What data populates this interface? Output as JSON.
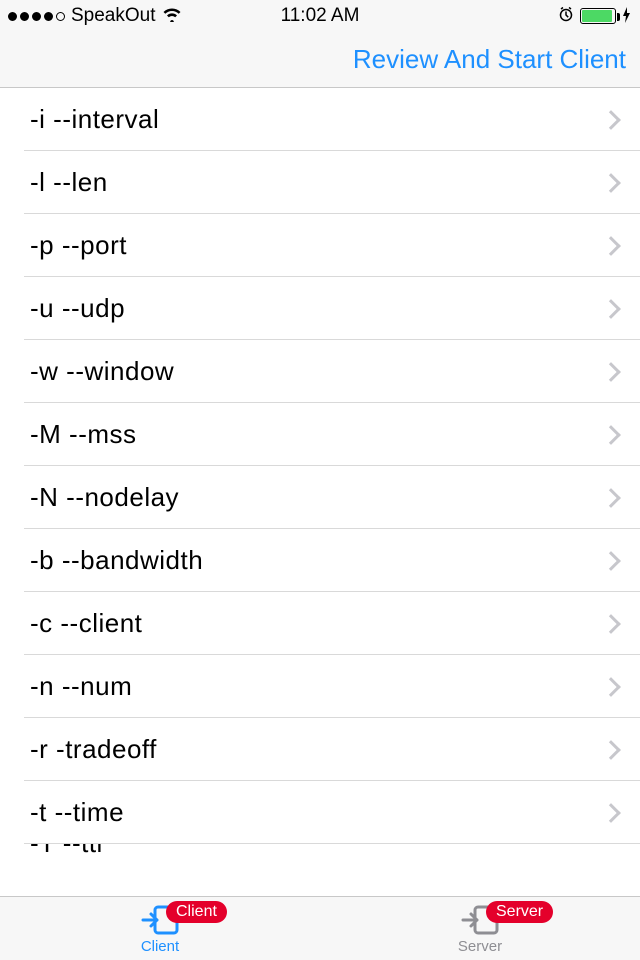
{
  "status": {
    "carrier": "SpeakOut",
    "time": "11:02 AM"
  },
  "nav": {
    "action_label": "Review And Start Client"
  },
  "options": [
    {
      "label": "-i  --interval"
    },
    {
      "label": "-l  --len"
    },
    {
      "label": "-p  --port"
    },
    {
      "label": "-u  --udp"
    },
    {
      "label": "-w  --window"
    },
    {
      "label": "-M  --mss"
    },
    {
      "label": "-N  --nodelay"
    },
    {
      "label": "-b --bandwidth"
    },
    {
      "label": "-c --client"
    },
    {
      "label": "-n --num"
    },
    {
      "label": "-r -tradeoff"
    },
    {
      "label": "-t --time"
    },
    {
      "label": "-T --ttl"
    }
  ],
  "tabs": {
    "client": {
      "label": "Client",
      "badge": "Client"
    },
    "server": {
      "label": "Server",
      "badge": "Server"
    }
  }
}
